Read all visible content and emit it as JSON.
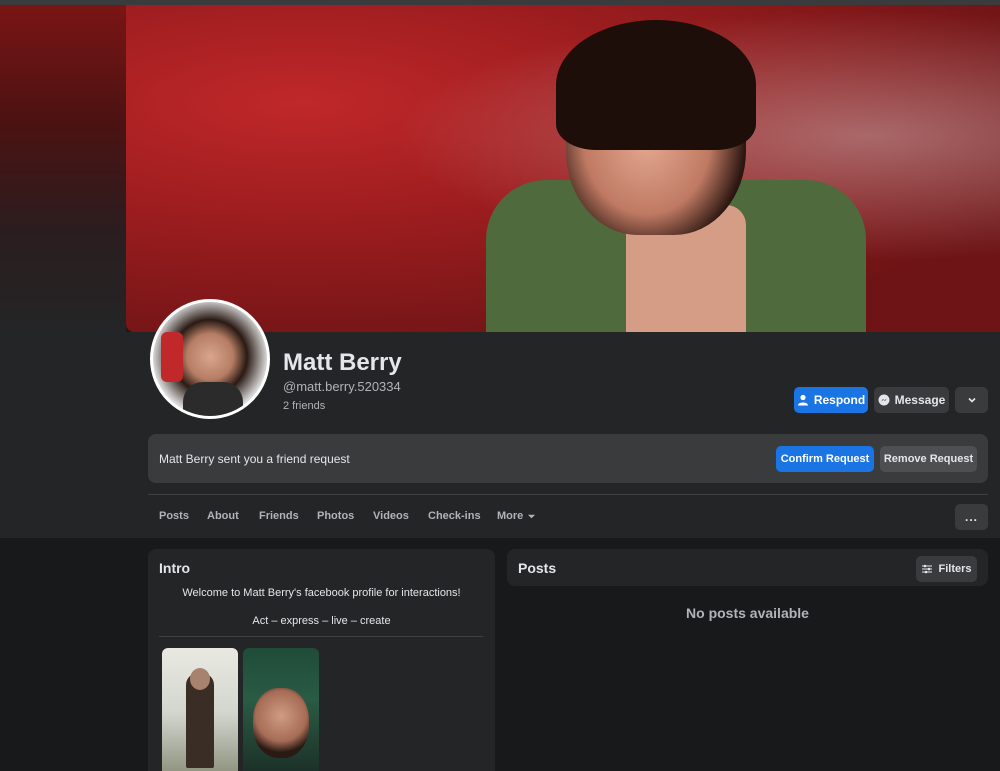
{
  "profile": {
    "name": "Matt Berry",
    "handle": "@matt.berry.520334",
    "friends": "2 friends"
  },
  "actions": {
    "respond": "Respond",
    "message": "Message",
    "more_icon": "chevron-down-icon"
  },
  "friend_request": {
    "text": "Matt Berry sent you a friend request",
    "confirm": "Confirm Request",
    "remove": "Remove Request"
  },
  "tabs": [
    {
      "label": "Posts"
    },
    {
      "label": "About"
    },
    {
      "label": "Friends"
    },
    {
      "label": "Photos"
    },
    {
      "label": "Videos"
    },
    {
      "label": "Check-ins"
    },
    {
      "label": "More"
    }
  ],
  "tabs_overflow": "...",
  "intro": {
    "title": "Intro",
    "bio": "Welcome to Matt Berry's facebook profile for interactions!",
    "tagline": "Act – express – live – create"
  },
  "posts": {
    "title": "Posts",
    "filters": "Filters",
    "empty": "No posts available"
  },
  "colors": {
    "accent": "#1b74e4",
    "background": "#18191a",
    "card": "#242526",
    "button": "#3a3b3c"
  }
}
